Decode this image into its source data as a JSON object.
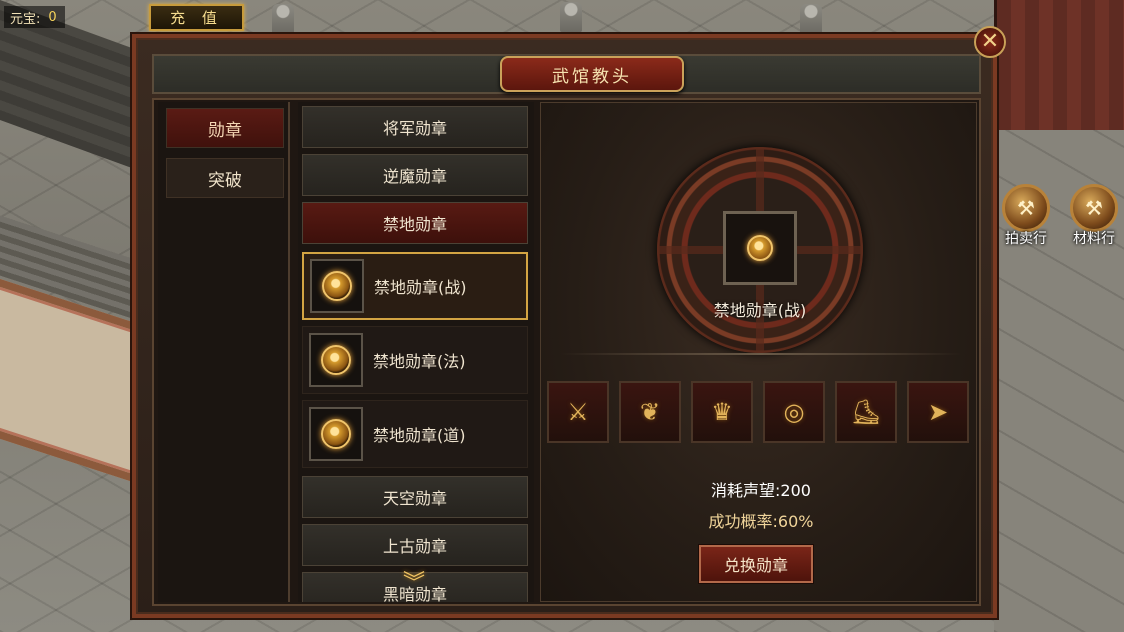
{
  "hud": {
    "currency_label": "元宝:",
    "currency_value": "0",
    "recharge_label": "充 值"
  },
  "side_buttons": [
    {
      "label": "拍卖行",
      "icon": "auction-hammer-icon"
    },
    {
      "label": "材料行",
      "icon": "materials-hammer-icon"
    }
  ],
  "panel": {
    "title": "武馆教头",
    "close_icon": "close-x-icon"
  },
  "categories": [
    {
      "label": "勋章",
      "active": true
    },
    {
      "label": "突破",
      "active": false
    }
  ],
  "medal_list": {
    "items_top": [
      {
        "label": "将军勋章",
        "active": false
      },
      {
        "label": "逆魔勋章",
        "active": false
      },
      {
        "label": "禁地勋章",
        "active": true
      }
    ],
    "sub_items": [
      {
        "label": "禁地勋章(战)",
        "selected": true
      },
      {
        "label": "禁地勋章(法)",
        "selected": false
      },
      {
        "label": "禁地勋章(道)",
        "selected": false
      }
    ],
    "items_bottom": [
      {
        "label": "天空勋章"
      },
      {
        "label": "上古勋章"
      },
      {
        "label": "黑暗勋章"
      }
    ]
  },
  "detail": {
    "selected_name": "禁地勋章(战)",
    "required_items": [
      {
        "icon": "weapon-icon",
        "glyph": "⚔"
      },
      {
        "icon": "necklace-icon",
        "glyph": "❦"
      },
      {
        "icon": "helmet-icon",
        "glyph": "♛"
      },
      {
        "icon": "ring-icon",
        "glyph": "◎"
      },
      {
        "icon": "boots-icon",
        "glyph": "⛸"
      },
      {
        "icon": "belt-icon",
        "glyph": "➤"
      }
    ],
    "cost_text": "消耗声望:200",
    "success_rate_text": "成功概率:60%",
    "exchange_button": "兑换勋章"
  },
  "colors": {
    "accent_gold": "#d3a443",
    "active_red": "#581a13",
    "panel_border": "#7b3a22"
  }
}
